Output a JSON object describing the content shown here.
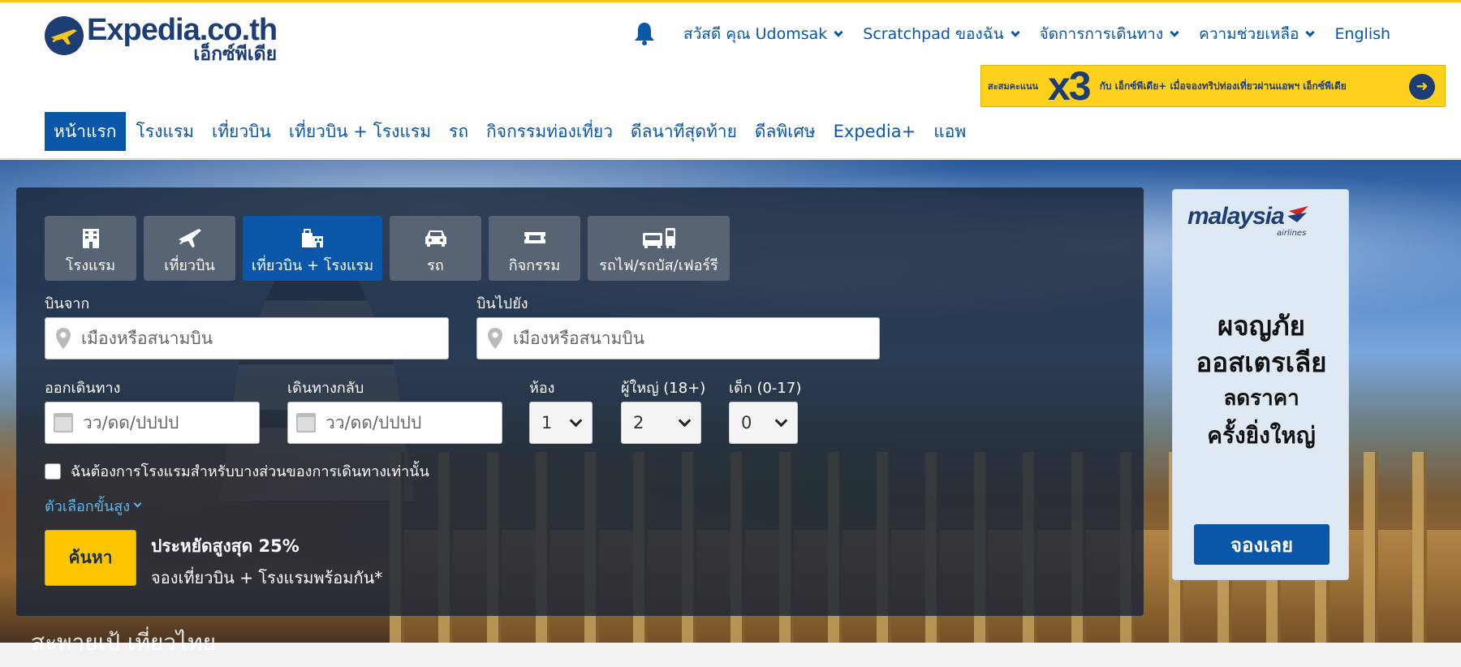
{
  "logo": {
    "main": "Expedia.co.th",
    "sub": "เอ็กซ์พีเดีย"
  },
  "utility": {
    "items": [
      {
        "label": "สวัสดี คุณ Udomsak",
        "dropdown": true
      },
      {
        "label": "Scratchpad ของฉัน",
        "dropdown": true
      },
      {
        "label": "จัดการการเดินทาง",
        "dropdown": true
      },
      {
        "label": "ความช่วยเหลือ",
        "dropdown": true
      },
      {
        "label": "English",
        "dropdown": false
      }
    ]
  },
  "promo": {
    "left": "สะสมคะแนน",
    "multiplier": "x3",
    "right": "กับ เอ็กซ์พีเดีย+ เมื่อจองทริปท่องเที่ยวผ่านแอพฯ เอ็กซ์พีเดีย"
  },
  "nav": {
    "items": [
      "หน้าแรก",
      "โรงแรม",
      "เที่ยวบิน",
      "เที่ยวบิน + โรงแรม",
      "รถ",
      "กิจกรรมท่องเที่ยว",
      "ดีลนาทีสุดท้าย",
      "ดีลพิเศษ",
      "Expedia+",
      "แอพ"
    ],
    "active": "หน้าแรก"
  },
  "search": {
    "tabs": [
      {
        "label": "โรงแรม",
        "icon": "hotel-icon"
      },
      {
        "label": "เที่ยวบิน",
        "icon": "plane-icon"
      },
      {
        "label": "เที่ยวบิน + โรงแรม",
        "icon": "flight-hotel-icon"
      },
      {
        "label": "รถ",
        "icon": "car-icon"
      },
      {
        "label": "กิจกรรม",
        "icon": "ticket-icon"
      },
      {
        "label": "รถไฟ/รถบัส/เฟอร์รี",
        "icon": "train-bus-icon"
      }
    ],
    "active_tab": "เที่ยวบิน + โรงแรม",
    "from_label": "บินจาก",
    "from_placeholder": "เมืองหรือสนามบิน",
    "to_label": "บินไปยัง",
    "to_placeholder": "เมืองหรือสนามบิน",
    "depart_label": "ออกเดินทาง",
    "depart_placeholder": "วว/ดด/ปปปป",
    "return_label": "เดินทางกลับ",
    "return_placeholder": "วว/ดด/ปปปป",
    "rooms_label": "ห้อง",
    "rooms_value": "1",
    "adults_label": "ผู้ใหญ่ (18+)",
    "adults_value": "2",
    "children_label": "เด็ก (0-17)",
    "children_value": "0",
    "partial_hotel_label": "ฉันต้องการโรงแรมสำหรับบางส่วนของการเดินทางเท่านั้น",
    "advanced_label": "ตัวเลือกขั้นสูง",
    "search_button": "ค้นหา",
    "save_line1": "ประหยัดสูงสุด 25%",
    "save_line2": "จองเที่ยวบิน + โรงแรมพร้อมกัน*"
  },
  "hero_caption": "สะพายเป้ เที่ยวไทย",
  "ad": {
    "brand": "malaysia",
    "brand_sub": "airlines",
    "line1": "ผจญภัย",
    "line2": "ออสเตรเลีย",
    "line3": "ลดราคา",
    "line4": "ครั้งยิ่งใหญ่",
    "button": "จองเลย"
  },
  "colors": {
    "brand_blue": "#0a56a8",
    "navy": "#1d3e75",
    "yellow": "#fdc500"
  }
}
